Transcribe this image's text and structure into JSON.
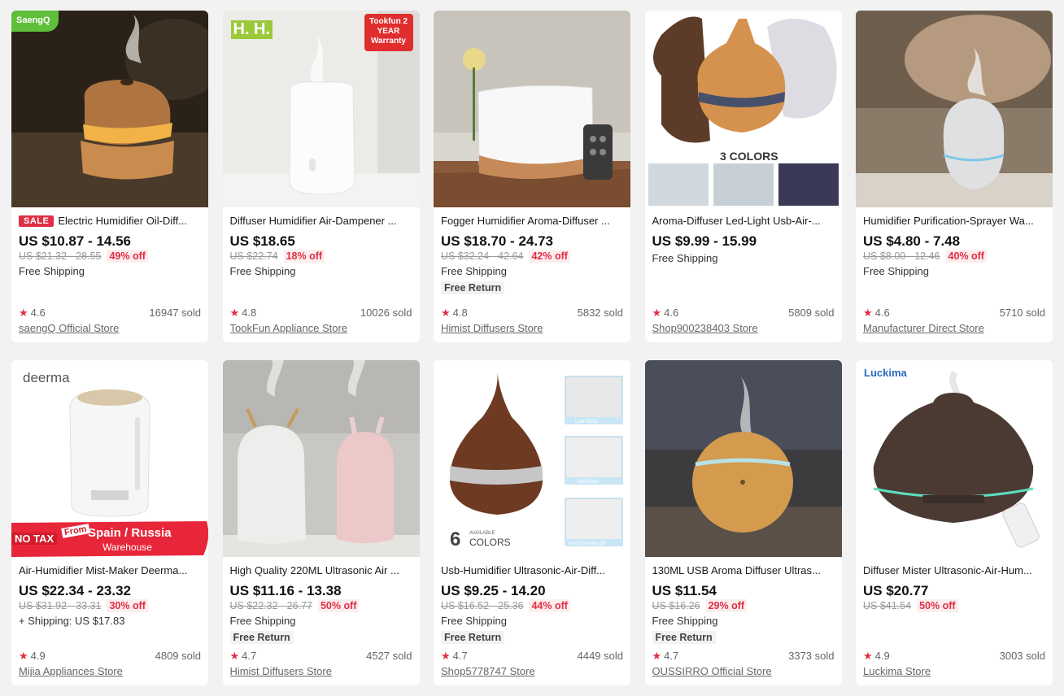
{
  "products": [
    {
      "title": "Electric Humidifier Oil-Diff...",
      "sale_badge": "SALE",
      "price": "US $10.87 - 14.56",
      "original_price": "US $21.32 - 28.55",
      "discount": "49% off",
      "shipping": "Free Shipping",
      "free_return": "",
      "rating": "4.6",
      "sold": "16947 sold",
      "store": "saengQ Official Store",
      "brand_mark": "SaengQ"
    },
    {
      "title": "Diffuser Humidifier Air-Dampener ...",
      "sale_badge": "",
      "price": "US $18.65",
      "original_price": "US $22.74",
      "discount": "18% off",
      "shipping": "Free Shipping",
      "free_return": "",
      "rating": "4.8",
      "sold": "10026 sold",
      "store": "TookFun Appliance Store",
      "brand_mark": "H. H.",
      "corner_badge": "Tookfun 2 YEAR Warranty"
    },
    {
      "title": "Fogger Humidifier Aroma-Diffuser ...",
      "sale_badge": "",
      "price": "US $18.70 - 24.73",
      "original_price": "US $32.24 - 42.64",
      "discount": "42% off",
      "shipping": "Free Shipping",
      "free_return": "Free Return",
      "rating": "4.8",
      "sold": "5832 sold",
      "store": "Himist Diffusers Store"
    },
    {
      "title": "Aroma-Diffuser Led-Light Usb-Air-...",
      "sale_badge": "",
      "price": "US $9.99 - 15.99",
      "original_price": "",
      "discount": "",
      "shipping": "Free Shipping",
      "free_return": "",
      "rating": "4.6",
      "sold": "5809 sold",
      "store": "Shop900238403 Store",
      "image_caption": "3 COLORS"
    },
    {
      "title": "Humidifier Purification-Sprayer Wa...",
      "sale_badge": "",
      "price": "US $4.80 - 7.48",
      "original_price": "US $8.00 - 12.46",
      "discount": "40% off",
      "shipping": "Free Shipping",
      "free_return": "",
      "rating": "4.6",
      "sold": "5710 sold",
      "store": "Manufacturer Direct Store"
    },
    {
      "title": "Air-Humidifier Mist-Maker Deerma...",
      "sale_badge": "",
      "price": "US $22.34 - 23.32",
      "original_price": "US $31.92 - 33.31",
      "discount": "30% off",
      "shipping": "+ Shipping: US $17.83",
      "free_return": "",
      "rating": "4.9",
      "sold": "4809 sold",
      "store": "Mijia Appliances Store",
      "brand_mark": "deerma",
      "banner_left": "NO TAX",
      "banner_from": "From",
      "banner_main": "Spain / Russia",
      "banner_sub": "Warehouse"
    },
    {
      "title": "High Quality 220ML Ultrasonic Air ...",
      "sale_badge": "",
      "price": "US $11.16 - 13.38",
      "original_price": "US $22.32 - 26.77",
      "discount": "50% off",
      "shipping": "Free Shipping",
      "free_return": "Free Return",
      "rating": "4.7",
      "sold": "4527 sold",
      "store": "Himist Diffusers Store"
    },
    {
      "title": "Usb-Humidifier Ultrasonic-Air-Diff...",
      "sale_badge": "",
      "price": "US $9.25 - 14.20",
      "original_price": "US $16.52 - 25.36",
      "discount": "44% off",
      "shipping": "Free Shipping",
      "free_return": "Free Return",
      "rating": "4.7",
      "sold": "4449 sold",
      "store": "Shop5778747 Store",
      "image_caption_num": "6",
      "image_caption_small": "AVAILABLE",
      "image_caption": "COLORS",
      "panel_labels": [
        "Low Noise",
        "Add Water",
        "Add Essential Oil"
      ]
    },
    {
      "title": "130ML USB Aroma Diffuser Ultras...",
      "sale_badge": "",
      "price": "US $11.54",
      "original_price": "US $16.26",
      "discount": "29% off",
      "shipping": "Free Shipping",
      "free_return": "Free Return",
      "rating": "4.7",
      "sold": "3373 sold",
      "store": "OUSSIRRO Official Store"
    },
    {
      "title": "Diffuser Mister Ultrasonic-Air-Hum...",
      "sale_badge": "",
      "price": "US $20.77",
      "original_price": "US $41.54",
      "discount": "50% off",
      "shipping": "",
      "free_return": "",
      "rating": "4.9",
      "sold": "3003 sold",
      "store": "Luckima Store",
      "brand_mark": "Luckima"
    }
  ],
  "colors": {
    "accent_red": "#e02e44",
    "page_bg": "#f2f2f2",
    "card_bg": "#ffffff",
    "wood_light": "#c98c4e",
    "wood_dark": "#5a3a24"
  }
}
